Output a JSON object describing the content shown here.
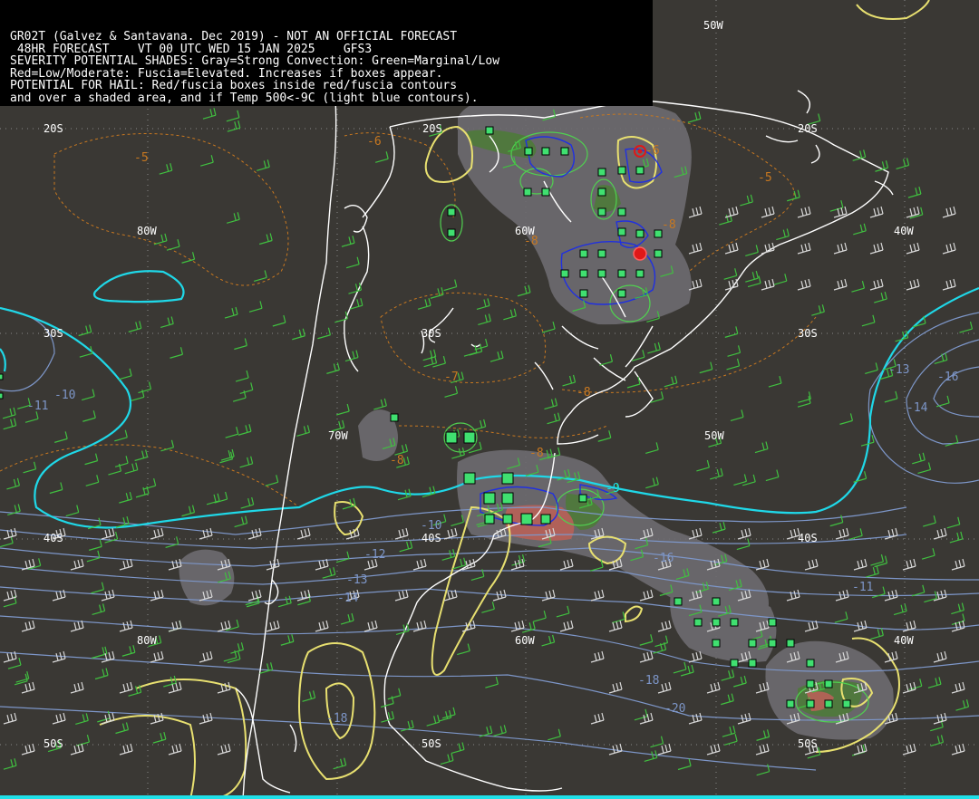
{
  "header": {
    "lines": [
      "GR02T (Galvez & Santavana. Dec 2019) - NOT AN OFFICIAL FORECAST",
      " 48HR FORECAST    VT 00 UTC WED 15 JAN 2025    GFS3",
      "SEVERITY POTENTIAL SHADES: Gray=Strong Convection: Green=Marginal/Low",
      "Red=Low/Moderate: Fuscia=Elevated. Increases if boxes appear.",
      "POTENTIAL FOR HAIL: Red/fuscia boxes inside red/fuscia contours",
      "and over a shaded area, and if Temp 500<-9C (light blue contours)."
    ]
  },
  "map": {
    "colors": {
      "background": "#3a3834",
      "coastline": "#ffffff",
      "temp_isotherm": "#7d96c8",
      "temp_cyan": "#1fd8e8",
      "orange_contour": "#c87820",
      "yellow_contour": "#e8e070",
      "green_contour": "#50d050",
      "blue_contour": "#2030e0",
      "gray_shade": "#6e6c70",
      "green_shade": "#4e7a3a",
      "red_shade": "#b86058",
      "box_green": "#40e070",
      "hail_red": "#e01818",
      "wind_green": "#40c040",
      "wind_white": "#d8d8d8"
    },
    "coord_labels": [
      {
        "id": "lat-20s-left",
        "text": "20S"
      },
      {
        "id": "lat-20s-mid",
        "text": "20S"
      },
      {
        "id": "lat-20s-right",
        "text": "20S"
      },
      {
        "id": "lon-50w-top",
        "text": "50W"
      },
      {
        "id": "lon-80w-top",
        "text": "80W"
      },
      {
        "id": "lon-60w-top",
        "text": "60W"
      },
      {
        "id": "lon-40w-top",
        "text": "40W"
      },
      {
        "id": "lat-30s-left",
        "text": "30S"
      },
      {
        "id": "lat-30s-mid",
        "text": "30S"
      },
      {
        "id": "lat-30s-right",
        "text": "30S"
      },
      {
        "id": "lon-70w",
        "text": "70W"
      },
      {
        "id": "lon-50w-mid",
        "text": "50W"
      },
      {
        "id": "lat-40s-left",
        "text": "40S"
      },
      {
        "id": "lat-40s-mid",
        "text": "40S"
      },
      {
        "id": "lat-40s-right",
        "text": "40S"
      },
      {
        "id": "lon-80w-bot",
        "text": "80W"
      },
      {
        "id": "lon-60w-bot",
        "text": "60W"
      },
      {
        "id": "lon-40w-bot",
        "text": "40W"
      },
      {
        "id": "lat-50s-left",
        "text": "50S"
      },
      {
        "id": "lat-50s-mid",
        "text": "50S"
      },
      {
        "id": "lat-50s-right",
        "text": "50S"
      }
    ],
    "isotherm_labels": [
      {
        "id": "t-5a",
        "text": "-5"
      },
      {
        "id": "t-6a",
        "text": "-6"
      },
      {
        "id": "t-6b",
        "text": "-6"
      },
      {
        "id": "t-5b",
        "text": "-5"
      },
      {
        "id": "t-8a",
        "text": "-8"
      },
      {
        "id": "t-8b",
        "text": "-8"
      },
      {
        "id": "t-7",
        "text": "-7"
      },
      {
        "id": "t-8c",
        "text": "-8"
      },
      {
        "id": "t-8d",
        "text": "-8"
      },
      {
        "id": "t-8e",
        "text": "-8"
      },
      {
        "id": "t-9",
        "text": "-9"
      },
      {
        "id": "t-10a",
        "text": "-10"
      },
      {
        "id": "t-11a",
        "text": "-11"
      },
      {
        "id": "t-10b",
        "text": "-10"
      },
      {
        "id": "t-11b",
        "text": "-11"
      },
      {
        "id": "t-12",
        "text": "-12"
      },
      {
        "id": "t-13",
        "text": "-13"
      },
      {
        "id": "t-14a",
        "text": "-14"
      },
      {
        "id": "t-13b",
        "text": "-13"
      },
      {
        "id": "t-16a",
        "text": "-16"
      },
      {
        "id": "t-14b",
        "text": "-14"
      },
      {
        "id": "t-11c",
        "text": "-11"
      },
      {
        "id": "t-18a",
        "text": "-18"
      },
      {
        "id": "t-20",
        "text": "-20"
      },
      {
        "id": "t-18b",
        "text": "-18"
      },
      {
        "id": "t-16b",
        "text": "-16"
      }
    ]
  }
}
